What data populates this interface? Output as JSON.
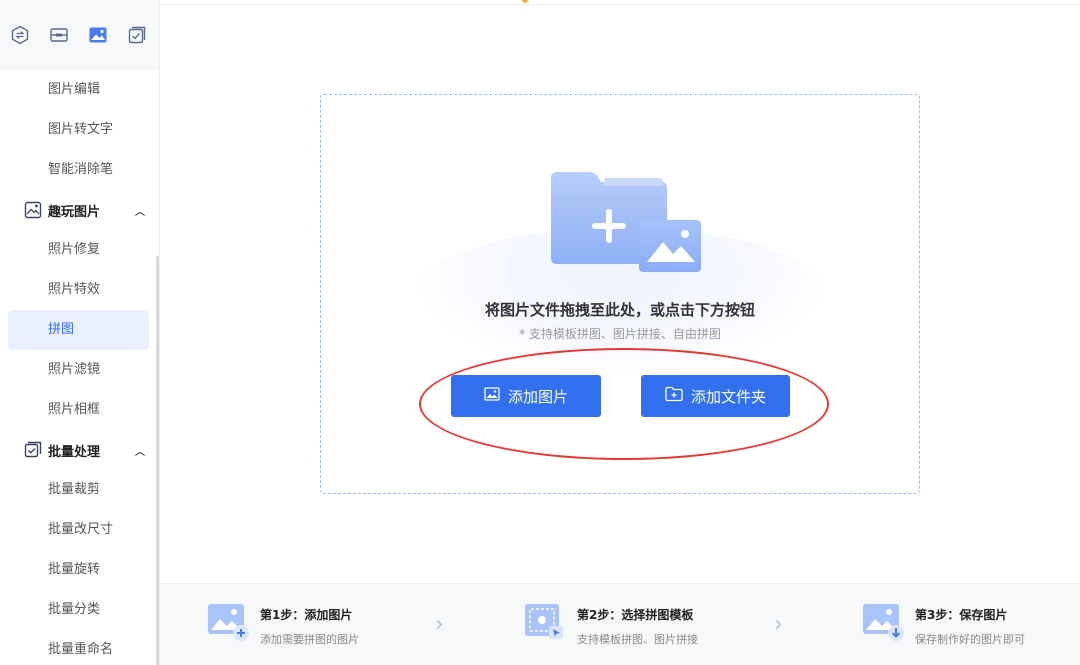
{
  "sidebar": {
    "top_icons": [
      "convert-icon",
      "layout-icon",
      "image-icon",
      "checklist-icon"
    ],
    "items_before": [
      {
        "label": "图片编辑"
      },
      {
        "label": "图片转文字"
      },
      {
        "label": "智能消除笔"
      }
    ],
    "group_fun": {
      "label": "趣玩图片",
      "icon": "fun-image-icon",
      "expanded": true
    },
    "fun_items": [
      {
        "label": "照片修复"
      },
      {
        "label": "照片特效"
      },
      {
        "label": "拼图",
        "active": true
      },
      {
        "label": "照片滤镜"
      },
      {
        "label": "照片相框"
      }
    ],
    "group_batch": {
      "label": "批量处理",
      "icon": "batch-check-icon",
      "expanded": true
    },
    "batch_items": [
      {
        "label": "批量裁剪"
      },
      {
        "label": "批量改尺寸"
      },
      {
        "label": "批量旋转"
      },
      {
        "label": "批量分类"
      },
      {
        "label": "批量重命名"
      }
    ]
  },
  "dropzone": {
    "title": "将图片文件拖拽至此处，或点击下方按钮",
    "subtitle": "* 支持模板拼图、图片拼接、自由拼图",
    "add_image_label": "添加图片",
    "add_folder_label": "添加文件夹"
  },
  "steps": [
    {
      "title": "第1步：添加图片",
      "desc": "添加需要拼图的图片"
    },
    {
      "title": "第2步：选择拼图模板",
      "desc": "支持模板拼图、图片拼接"
    },
    {
      "title": "第3步：保存图片",
      "desc": "保存制作好的图片即可"
    }
  ],
  "colors": {
    "accent": "#3370ee",
    "active_bg": "#eaf0fd",
    "annotation": "#e53935"
  }
}
